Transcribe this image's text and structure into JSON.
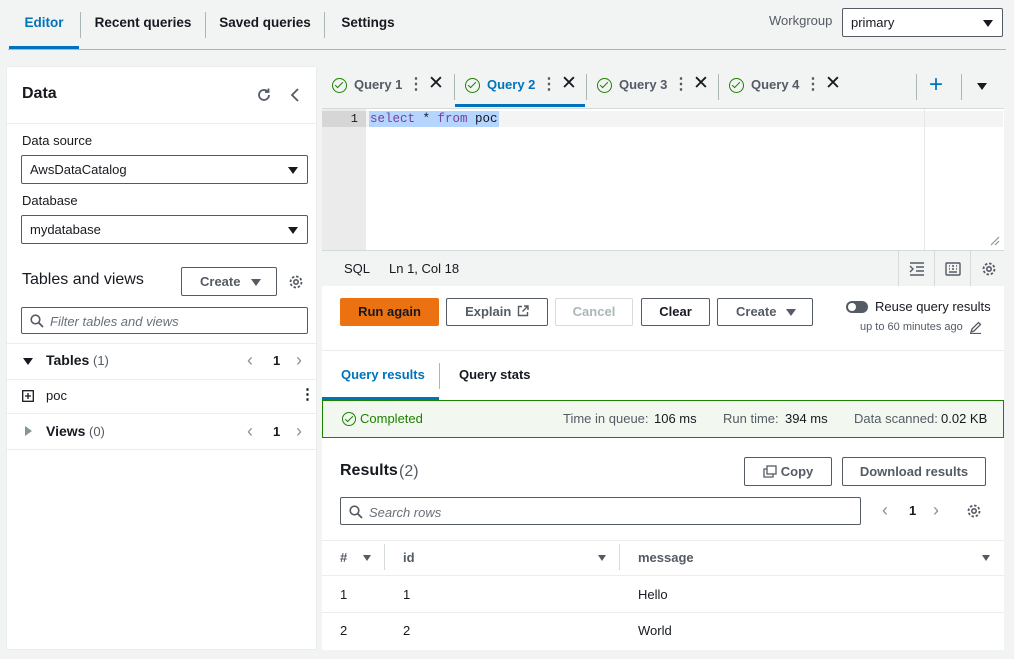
{
  "top_tabs": [
    "Editor",
    "Recent queries",
    "Saved queries",
    "Settings"
  ],
  "workgroup": {
    "label": "Workgroup",
    "value": "primary"
  },
  "data_panel": {
    "title": "Data",
    "data_source_label": "Data source",
    "data_source_value": "AwsDataCatalog",
    "database_label": "Database",
    "database_value": "mydatabase",
    "tables_views_title": "Tables and views",
    "create_label": "Create",
    "filter_placeholder": "Filter tables and views",
    "tables_label": "Tables",
    "tables_count": "(1)",
    "tables_page": "1",
    "table_items": [
      "poc"
    ],
    "views_label": "Views",
    "views_count": "(0)",
    "views_page": "1"
  },
  "query_tabs": [
    "Query 1",
    "Query 2",
    "Query 3",
    "Query 4"
  ],
  "editor": {
    "line_number": "1",
    "code_kw1": "select",
    "code_mid": " * ",
    "code_kw2": "from",
    "code_end": " poc"
  },
  "status_bar": {
    "language": "SQL",
    "position": "Ln 1, Col 18"
  },
  "actions": {
    "run": "Run again",
    "explain": "Explain",
    "cancel": "Cancel",
    "clear": "Clear",
    "create": "Create",
    "reuse_label": "Reuse query results",
    "reuse_sub": "up to 60 minutes ago"
  },
  "result_tabs": [
    "Query results",
    "Query stats"
  ],
  "banner": {
    "status": "Completed",
    "queue_label": "Time in queue:",
    "queue_value": "106 ms",
    "run_label": "Run time:",
    "run_value": "394 ms",
    "scan_label": "Data scanned:",
    "scan_value": "0.02 KB"
  },
  "results": {
    "title": "Results",
    "count": "(2)",
    "copy": "Copy",
    "download": "Download results",
    "search_placeholder": "Search rows",
    "page": "1",
    "columns": [
      "#",
      "id",
      "message"
    ],
    "rows": [
      [
        "1",
        "1",
        "Hello"
      ],
      [
        "2",
        "2",
        "World"
      ]
    ]
  },
  "colors": {
    "accent": "#0073bb",
    "run_button": "#ec7211",
    "success": "#1d8102"
  }
}
